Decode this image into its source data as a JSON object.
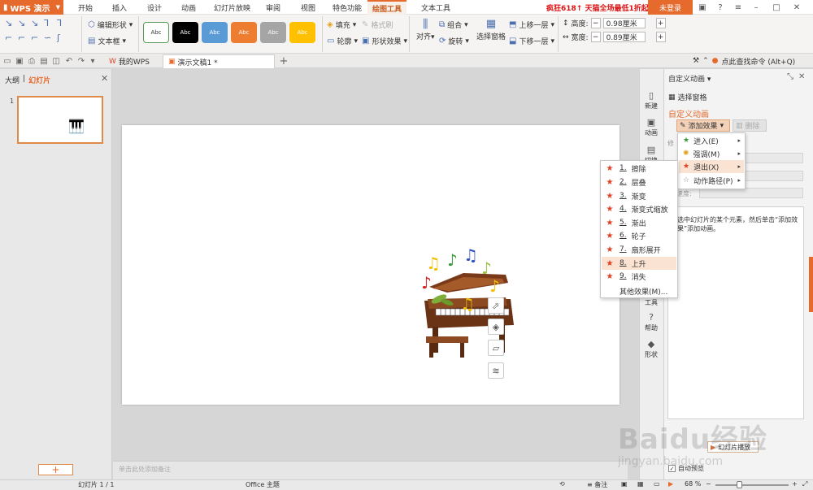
{
  "app": {
    "name": "WPS 演示"
  },
  "ribbon_tabs": [
    "开始",
    "插入",
    "设计",
    "动画",
    "幻灯片放映",
    "审阅",
    "视图",
    "特色功能",
    "绘图工具",
    "文本工具"
  ],
  "active_tab": "绘图工具",
  "promo": "疯狂618↑ 天猫全场最低1折起",
  "login": "未登录",
  "ribbon": {
    "edit_shape": "编辑形状",
    "text_box": "文本框",
    "style_label": "Abc",
    "style_colors": [
      "#ffffff",
      "#000000",
      "#5b9bd5",
      "#ed7d31",
      "#a5a5a5",
      "#ffc000"
    ],
    "fill": "填充",
    "format_painter": "格式刷",
    "outline": "轮廓",
    "shape_effect": "形状效果",
    "align": "对齐",
    "group": "组合",
    "rotate": "旋转",
    "select_pane": "选择窗格",
    "bring_forward": "上移一层",
    "send_backward": "下移一层",
    "height_label": "高度:",
    "height_value": "0.98厘米",
    "width_label": "宽度:",
    "width_value": "0.89厘米"
  },
  "doc_tabs": {
    "my_wps": "我的WPS",
    "current": "演示文稿1 *"
  },
  "cmd_search": "点此查找命令 (Alt+Q)",
  "left_pane": {
    "tab_outline": "大纲",
    "tab_slides": "幻灯片",
    "slide_number": "1"
  },
  "notes_placeholder": "单击此处添加备注",
  "right_tools": [
    "新建",
    "动画",
    "切换",
    "工具",
    "帮助",
    "形状"
  ],
  "task_pane": {
    "title": "自定义动画",
    "select_pane": "选择窗格",
    "heading": "自定义动画",
    "add_effect": "添加效果",
    "delete": "删除",
    "modify_label": "修",
    "speed_label": "速度:",
    "hint": "选中幻灯片的某个元素，然后单击“添加效果”添加动画。",
    "play": "幻灯片播放",
    "auto_preview": "自动预览"
  },
  "effect_submenu": [
    {
      "label": "进入(E)",
      "color": "#3a9a3a"
    },
    {
      "label": "强调(M)",
      "color": "#e0a020"
    },
    {
      "label": "退出(X)",
      "color": "#e04020"
    },
    {
      "label": "动作路径(P)",
      "color": "#888888"
    }
  ],
  "exit_effects": [
    {
      "num": "1.",
      "label": "擦除"
    },
    {
      "num": "2.",
      "label": "层叠"
    },
    {
      "num": "3.",
      "label": "渐变"
    },
    {
      "num": "4.",
      "label": "渐变式缩放"
    },
    {
      "num": "5.",
      "label": "渐出"
    },
    {
      "num": "6.",
      "label": "轮子"
    },
    {
      "num": "7.",
      "label": "扇形展开"
    },
    {
      "num": "8.",
      "label": "上升"
    },
    {
      "num": "9.",
      "label": "消失"
    }
  ],
  "more_effects": "其他效果(M)...",
  "status": {
    "slide": "幻灯片 1 / 1",
    "theme": "Office 主题",
    "notes": "备注",
    "zoom": "68 %"
  },
  "watermark": "Baidu经验",
  "watermark_sub": "jingyan.baidu.com"
}
